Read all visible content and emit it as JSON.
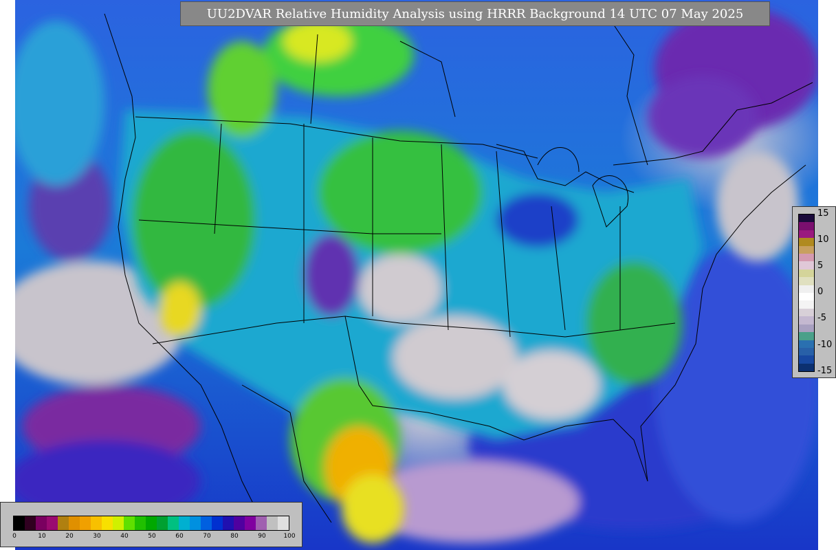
{
  "title": "UU2DVAR Relative Humidity Analysis using HRRR Background 14 UTC 07 May 2025",
  "right_colorbar": {
    "ticks": [
      "15",
      "10",
      "5",
      "0",
      "-5",
      "-10",
      "-15"
    ],
    "colors": [
      "#1a0a3a",
      "#7a0f6e",
      "#9a1a7e",
      "#b08a20",
      "#c8a060",
      "#d49ab0",
      "#e0c8d8",
      "#d4d49a",
      "#e0e0c0",
      "#f0f0f0",
      "#ffffff",
      "#f4f4f4",
      "#d8d0d8",
      "#c4b8d0",
      "#a8a0c0",
      "#4aa08a",
      "#2a70b0",
      "#2860a8",
      "#1848a0",
      "#0c3070"
    ]
  },
  "bottom_colorbar": {
    "ticks": [
      "0",
      "10",
      "20",
      "30",
      "40",
      "50",
      "60",
      "70",
      "80",
      "90",
      "100"
    ],
    "colors": [
      "#000000",
      "#300020",
      "#7a0060",
      "#9a0a70",
      "#b08010",
      "#e09000",
      "#f0a000",
      "#f8c000",
      "#f8e000",
      "#d0f000",
      "#60e000",
      "#20c000",
      "#00a800",
      "#00a030",
      "#00c080",
      "#00b0d0",
      "#0090e0",
      "#0060e0",
      "#0030d0",
      "#2010b0",
      "#5000a0",
      "#8000a0",
      "#a060b0",
      "#c0c0c0",
      "#e0e0e0"
    ]
  },
  "map_colors": {
    "land_green": "#2ab840",
    "land_yellow": "#e8e020",
    "ocean_blue": "#1f6fd8",
    "dry_gray": "#d0cbd0",
    "humid_purple": "#8030b0"
  }
}
